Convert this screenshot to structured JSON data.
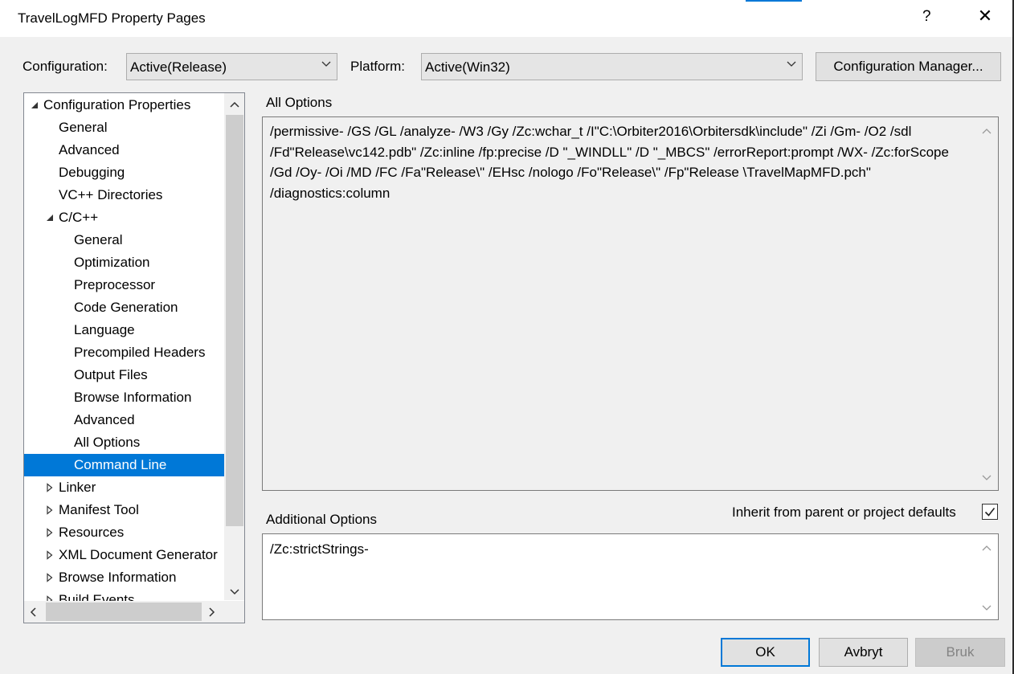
{
  "window": {
    "title": "TravelLogMFD Property Pages",
    "help_label": "?",
    "close_label": "✕"
  },
  "header": {
    "configuration_label": "Configuration:",
    "configuration_value": "Active(Release)",
    "platform_label": "Platform:",
    "platform_value": "Active(Win32)",
    "config_manager_label": "Configuration Manager..."
  },
  "tree": {
    "items": [
      {
        "label": "Configuration Properties",
        "expander": "expanded"
      },
      {
        "label": "General",
        "expander": "none"
      },
      {
        "label": "Advanced",
        "expander": "none"
      },
      {
        "label": "Debugging",
        "expander": "none"
      },
      {
        "label": "VC++ Directories",
        "expander": "none"
      },
      {
        "label": "C/C++",
        "expander": "expanded"
      },
      {
        "label": "General",
        "expander": "none"
      },
      {
        "label": "Optimization",
        "expander": "none"
      },
      {
        "label": "Preprocessor",
        "expander": "none"
      },
      {
        "label": "Code Generation",
        "expander": "none"
      },
      {
        "label": "Language",
        "expander": "none"
      },
      {
        "label": "Precompiled Headers",
        "expander": "none"
      },
      {
        "label": "Output Files",
        "expander": "none"
      },
      {
        "label": "Browse Information",
        "expander": "none"
      },
      {
        "label": "Advanced",
        "expander": "none"
      },
      {
        "label": "All Options",
        "expander": "none"
      },
      {
        "label": "Command Line",
        "expander": "none",
        "selected": true
      },
      {
        "label": "Linker",
        "expander": "collapsed"
      },
      {
        "label": "Manifest Tool",
        "expander": "collapsed"
      },
      {
        "label": "Resources",
        "expander": "collapsed"
      },
      {
        "label": "XML Document Generator",
        "expander": "collapsed"
      },
      {
        "label": "Browse Information",
        "expander": "collapsed"
      },
      {
        "label": "Build Events",
        "expander": "collapsed"
      }
    ]
  },
  "all_options": {
    "label": "All Options",
    "text": "/permissive- /GS /GL /analyze- /W3 /Gy /Zc:wchar_t /I\"C:\\Orbiter2016\\Orbitersdk\\include\" /Zi /Gm- /O2 /sdl /Fd\"Release\\vc142.pdb\" /Zc:inline /fp:precise /D \"_WINDLL\" /D \"_MBCS\" /errorReport:prompt /WX- /Zc:forScope /Gd /Oy- /Oi /MD /FC /Fa\"Release\\\" /EHsc /nologo /Fo\"Release\\\" /Fp\"Release \\TravelMapMFD.pch\" /diagnostics:column"
  },
  "additional_options": {
    "label": "Additional Options",
    "inherit_label": "Inherit from parent or project defaults",
    "inherit_checked": true,
    "text": "/Zc:strictStrings-"
  },
  "buttons": {
    "ok": "OK",
    "cancel": "Avbryt",
    "apply": "Bruk"
  },
  "colors": {
    "selection": "#0078d7",
    "window_bg": "#f0f0f0"
  }
}
